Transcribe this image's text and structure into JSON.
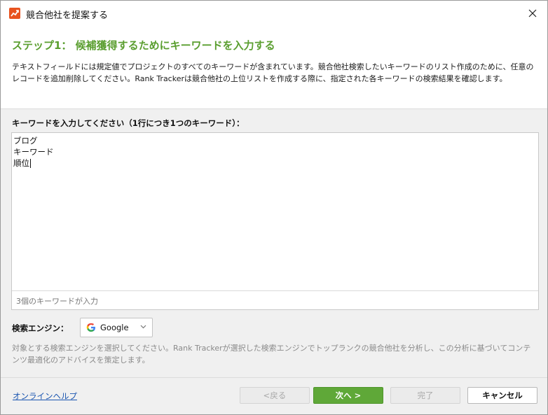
{
  "window": {
    "title": "競合他社を提案する",
    "icon": "rank-tracker-app-icon",
    "close_icon": "close-icon"
  },
  "header": {
    "step_title": "ステップ1： 候補獲得するためにキーワードを入力する",
    "description": "テキストフィールドには規定値でプロジェクトのすべてのキーワードが含まれています。競合他社検索したいキーワードのリスト作成のために、任意のレコードを追加削除してください。Rank Trackerは競合他社の上位リストを作成する際に、指定された各キーワードの検索結果を確認します。"
  },
  "keywords": {
    "label": "キーワードを入力してください（1行につき1つのキーワード）：",
    "items": [
      "ブログ",
      "キーワード",
      "順位"
    ],
    "count_text": "3個のキーワードが入力"
  },
  "search_engine": {
    "label": "検索エンジン：",
    "selected": "Google",
    "icon": "google-icon",
    "description": "対象とする検索エンジンを選択してください。Rank Trackerが選択した検索エンジンでトップランクの競合他社を分析し、この分析に基づいてコンテンツ最適化のアドバイスを策定します。"
  },
  "footer": {
    "help_link": "オンラインヘルプ",
    "back_label": "<戻る",
    "next_label": "次へ >",
    "done_label": "完了",
    "cancel_label": "キャンセル"
  },
  "colors": {
    "accent_green": "#5a9e2f",
    "next_button": "#5fa838",
    "link_blue": "#1a55b0",
    "app_icon": "#e8531f"
  }
}
